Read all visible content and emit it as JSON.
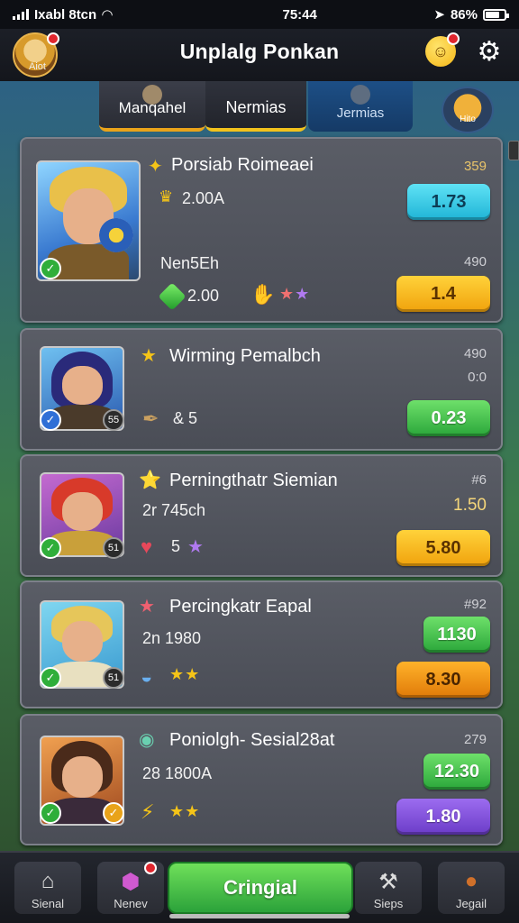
{
  "status_bar": {
    "carrier": "Ixabl 8tcn",
    "time": "75:44",
    "battery": "86%"
  },
  "header": {
    "title": "Unplalg Ponkan",
    "avatar_label": "Aiot"
  },
  "tabs": [
    {
      "label": "Manqahel"
    },
    {
      "label": "Nermias"
    },
    {
      "label": "Jermias"
    }
  ],
  "mascot_label": "Hito",
  "cards": [
    {
      "title": "Porsiab Roimeaei",
      "corner_top": "359",
      "line1": "2.00A",
      "price_top": "1.73",
      "subtitle": "Nen5Eh",
      "corner_mid": "490",
      "line2": "2.00",
      "price_bottom": "1.4"
    },
    {
      "title": "Wirming Pemalbch",
      "corner_top": "490",
      "corner_mid": "0:0",
      "level": "55",
      "line2": "& 5",
      "price_bottom": "0.23"
    },
    {
      "title": "Perningthatr Siemian",
      "corner_top": "#6",
      "line1": "2r 745ch",
      "corner_mid": "1.50",
      "level": "51",
      "line2": "5",
      "price_bottom": "5.80"
    },
    {
      "title": "Percingkatr Eapal",
      "corner_top": "#92",
      "line1": "2n 1980",
      "price_top": "1130",
      "level": "51",
      "price_bottom": "8.30"
    },
    {
      "title": "Poniolgh- Sesial28at",
      "corner_top": "279",
      "line1": "28 1800A",
      "price_top": "12.30",
      "price_bottom": "1.80"
    }
  ],
  "bottom_nav": {
    "left1": "Sienal",
    "left2": "Nenev",
    "center": "Cringial",
    "right1": "Sieps",
    "right2": "Jegail"
  },
  "colors": {
    "accent_green": "#2aa63a",
    "accent_yellow": "#f0a20c",
    "accent_blue": "#1fb4d6",
    "accent_purple": "#6b3cc8",
    "accent_orange": "#e07a08"
  }
}
